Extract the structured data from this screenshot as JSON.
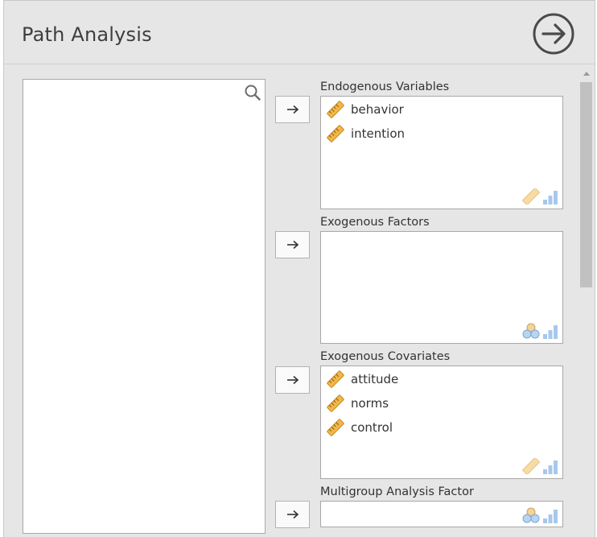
{
  "header": {
    "title": "Path Analysis"
  },
  "colors": {
    "panel_bg": "#e6e6e6",
    "ruler": "#f0b84a",
    "hint_blue": "#a7c8ec"
  },
  "icons": {
    "go": "arrow-circle-right-icon",
    "search": "search-icon",
    "move": "arrow-right-icon",
    "variable": "ruler-icon"
  },
  "endogenous": {
    "label": "Endogenous Variables",
    "items": [
      {
        "name": "behavior"
      },
      {
        "name": "intention"
      }
    ]
  },
  "exogenous_factors": {
    "label": "Exogenous Factors",
    "items": []
  },
  "exogenous_covariates": {
    "label": "Exogenous Covariates",
    "items": [
      {
        "name": "attitude"
      },
      {
        "name": "norms"
      },
      {
        "name": "control"
      }
    ]
  },
  "multigroup": {
    "label": "Multigroup Analysis Factor",
    "items": []
  }
}
